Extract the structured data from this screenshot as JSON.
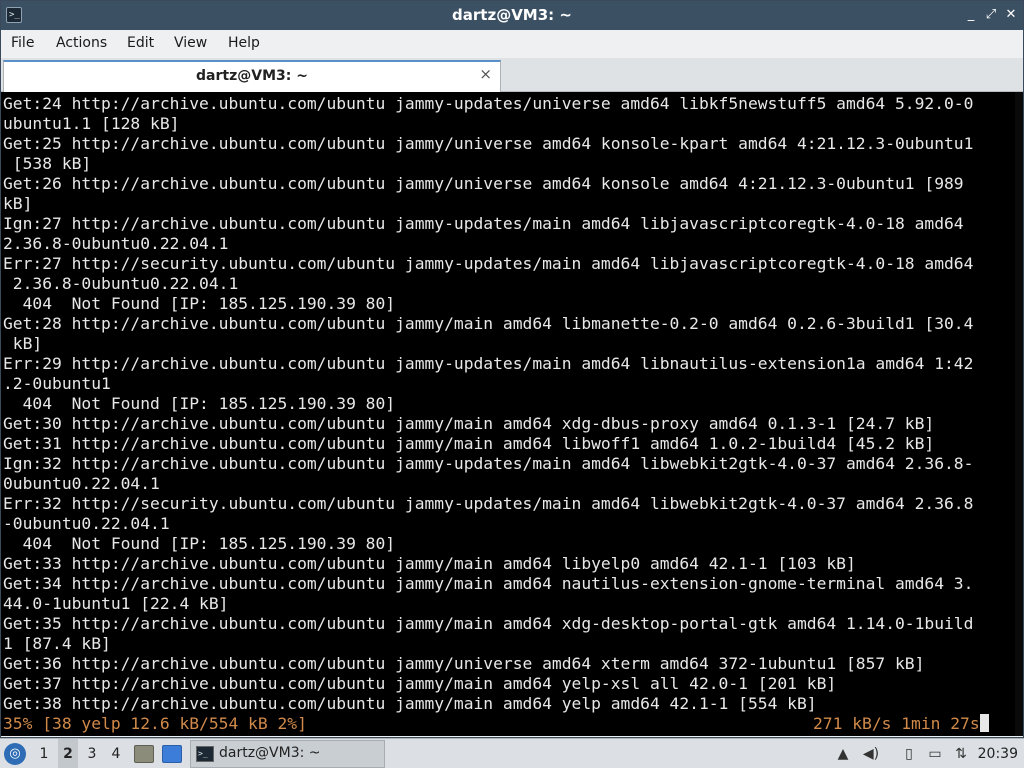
{
  "window": {
    "title": "dartz@VM3: ~",
    "app_icon": ">_",
    "buttons": {
      "minimize": "_",
      "maximize": "⤢",
      "close": "✕"
    }
  },
  "menubar": {
    "items": [
      "File",
      "Actions",
      "Edit",
      "View",
      "Help"
    ]
  },
  "tab": {
    "label": "dartz@VM3: ~",
    "close_icon": "×"
  },
  "terminal": {
    "lines": [
      "Get:24 http://archive.ubuntu.com/ubuntu jammy-updates/universe amd64 libkf5newstuff5 amd64 5.92.0-0",
      "ubuntu1.1 [128 kB]",
      "Get:25 http://archive.ubuntu.com/ubuntu jammy/universe amd64 konsole-kpart amd64 4:21.12.3-0ubuntu1",
      " [538 kB]",
      "Get:26 http://archive.ubuntu.com/ubuntu jammy/universe amd64 konsole amd64 4:21.12.3-0ubuntu1 [989",
      "kB]",
      "Ign:27 http://archive.ubuntu.com/ubuntu jammy-updates/main amd64 libjavascriptcoregtk-4.0-18 amd64",
      "2.36.8-0ubuntu0.22.04.1",
      "Err:27 http://security.ubuntu.com/ubuntu jammy-updates/main amd64 libjavascriptcoregtk-4.0-18 amd64",
      " 2.36.8-0ubuntu0.22.04.1",
      "  404  Not Found [IP: 185.125.190.39 80]",
      "Get:28 http://archive.ubuntu.com/ubuntu jammy/main amd64 libmanette-0.2-0 amd64 0.2.6-3build1 [30.4",
      " kB]",
      "Err:29 http://archive.ubuntu.com/ubuntu jammy-updates/main amd64 libnautilus-extension1a amd64 1:42",
      ".2-0ubuntu1",
      "  404  Not Found [IP: 185.125.190.39 80]",
      "Get:30 http://archive.ubuntu.com/ubuntu jammy/main amd64 xdg-dbus-proxy amd64 0.1.3-1 [24.7 kB]",
      "Get:31 http://archive.ubuntu.com/ubuntu jammy/main amd64 libwoff1 amd64 1.0.2-1build4 [45.2 kB]",
      "Ign:32 http://archive.ubuntu.com/ubuntu jammy-updates/main amd64 libwebkit2gtk-4.0-37 amd64 2.36.8-",
      "0ubuntu0.22.04.1",
      "Err:32 http://security.ubuntu.com/ubuntu jammy-updates/main amd64 libwebkit2gtk-4.0-37 amd64 2.36.8",
      "-0ubuntu0.22.04.1",
      "  404  Not Found [IP: 185.125.190.39 80]",
      "Get:33 http://archive.ubuntu.com/ubuntu jammy/main amd64 libyelp0 amd64 42.1-1 [103 kB]",
      "Get:34 http://archive.ubuntu.com/ubuntu jammy/main amd64 nautilus-extension-gnome-terminal amd64 3.",
      "44.0-1ubuntu1 [22.4 kB]",
      "Get:35 http://archive.ubuntu.com/ubuntu jammy/main amd64 xdg-desktop-portal-gtk amd64 1.14.0-1build",
      "1 [87.4 kB]",
      "Get:36 http://archive.ubuntu.com/ubuntu jammy/universe amd64 xterm amd64 372-1ubuntu1 [857 kB]",
      "Get:37 http://archive.ubuntu.com/ubuntu jammy/main amd64 yelp-xsl all 42.0-1 [201 kB]",
      "Get:38 http://archive.ubuntu.com/ubuntu jammy/main amd64 yelp amd64 42.1-1 [554 kB]"
    ],
    "status_left": "35% [38 yelp 12.6 kB/554 kB 2%]",
    "status_right": "271 kB/s 1min 27s",
    "status_color": "#d18a4a"
  },
  "taskbar": {
    "start_icon": "start-menu-icon",
    "workspaces": [
      "1",
      "2",
      "3",
      "4"
    ],
    "active_workspace": "2",
    "task_label": "dartz@VM3: ~",
    "clock": "20:39"
  }
}
